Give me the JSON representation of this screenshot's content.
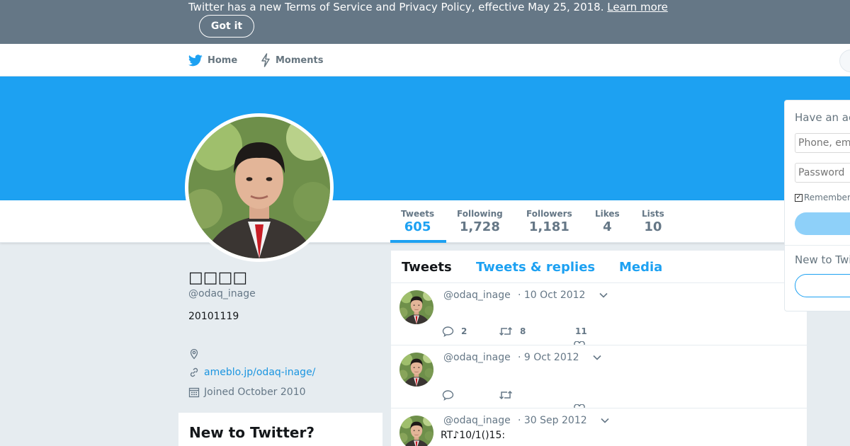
{
  "banner": {
    "text": "Twitter has a new Terms of Service and Privacy Policy, effective May 25, 2018.",
    "link": "Learn more",
    "button": "Got it"
  },
  "nav": {
    "home": "Home",
    "moments": "Moments"
  },
  "profile": {
    "name": "□□□□",
    "handle": "@odaq_inage",
    "bio": "20101119",
    "location": "",
    "url": "ameblo.jp/odaq-inage/",
    "joined": "Joined October 2010"
  },
  "stats": [
    {
      "label": "Tweets",
      "value": "605",
      "active": true
    },
    {
      "label": "Following",
      "value": "1,728"
    },
    {
      "label": "Followers",
      "value": "1,181"
    },
    {
      "label": "Likes",
      "value": "4"
    },
    {
      "label": "Lists",
      "value": "10"
    }
  ],
  "tabs": [
    "Tweets",
    "Tweets & replies",
    "Media"
  ],
  "tweets": [
    {
      "handle": "@odaq_inage",
      "date": "· 10 Oct 2012",
      "text": "",
      "replies": "2",
      "retweets": "8",
      "likes": "11"
    },
    {
      "handle": "@odaq_inage",
      "date": "· 9 Oct 2012",
      "text": "",
      "replies": "",
      "retweets": "",
      "likes": ""
    },
    {
      "handle": "@odaq_inage",
      "date": "· 30 Sep 2012",
      "text": "RT♪10/1()15:",
      "replies": "",
      "retweets": "",
      "likes": ""
    }
  ],
  "new_to_twitter": {
    "title": "New to Twitter?"
  },
  "login": {
    "heading": "Have an ac",
    "phone_placeholder": "Phone, em",
    "password_placeholder": "Password",
    "remember": "Remember",
    "new_to": "New to Twit"
  },
  "colors": {
    "brand": "#1da1f2",
    "banner": "#657786",
    "link": "#1b95e0"
  }
}
